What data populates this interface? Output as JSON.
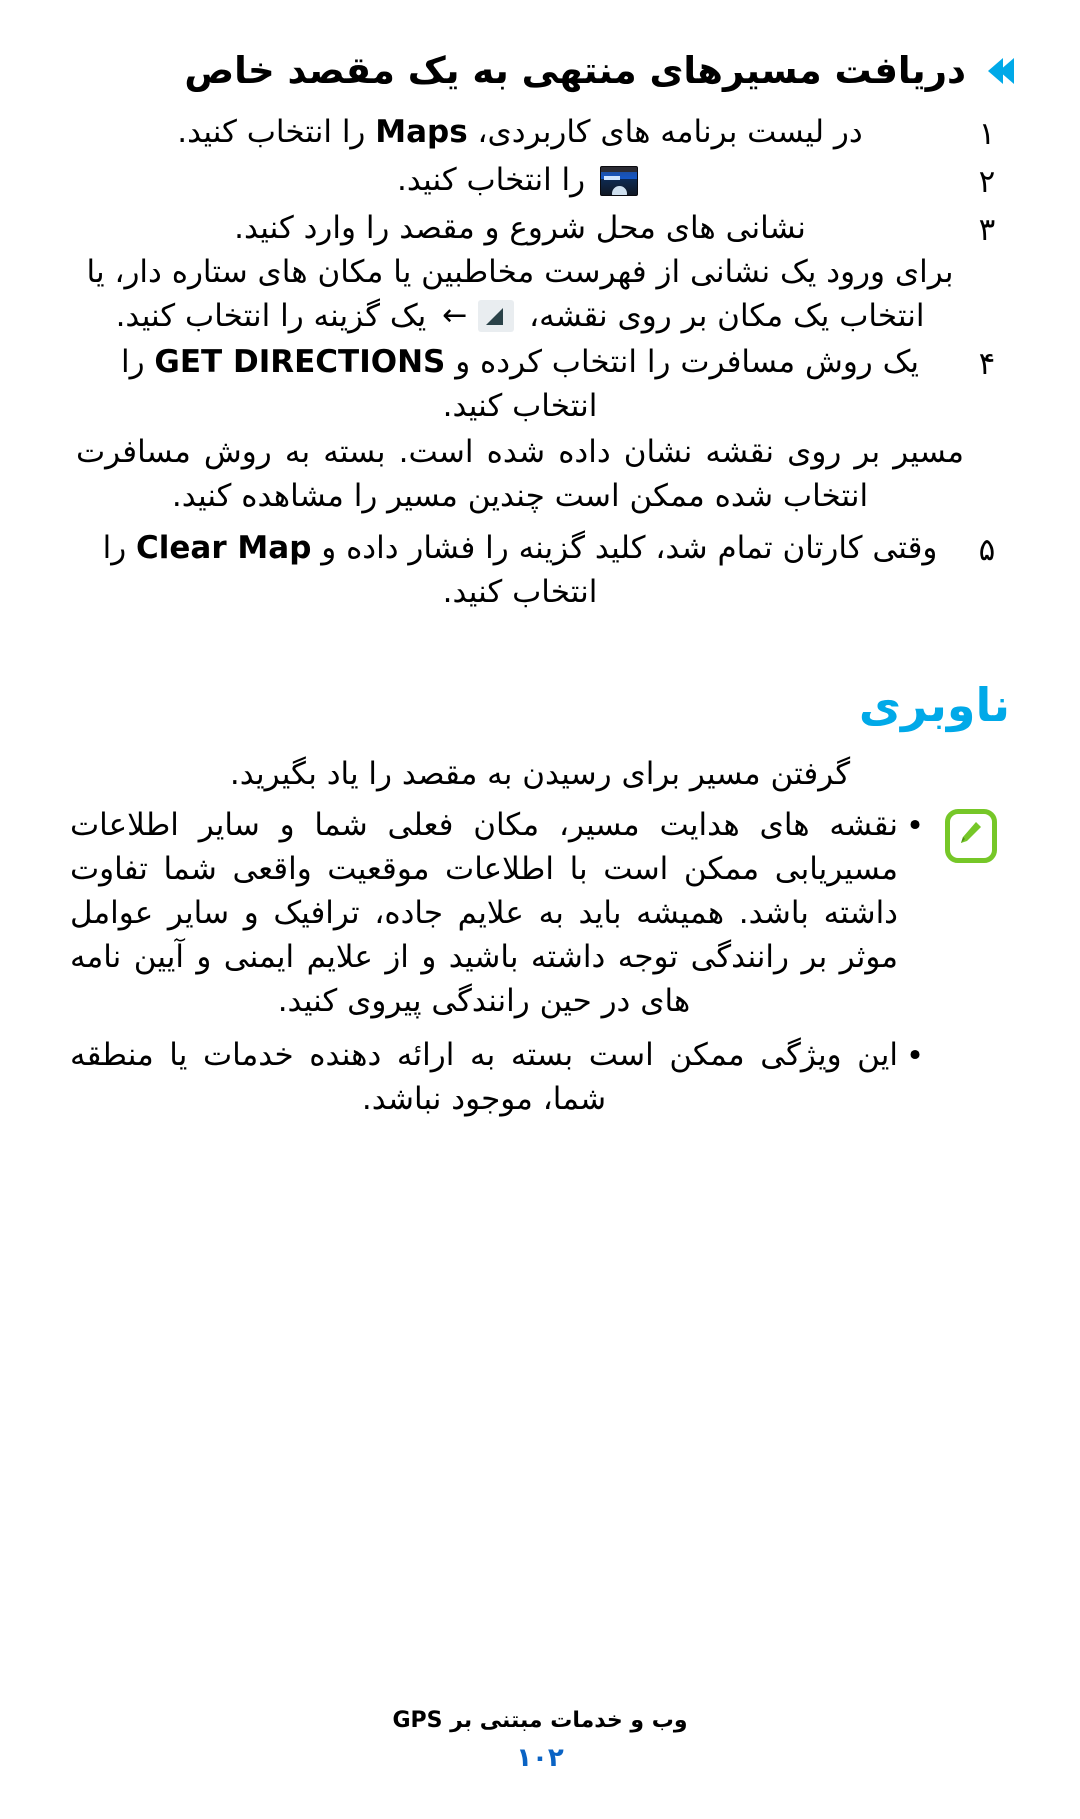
{
  "section": {
    "chevron_icon": "double-chevron-right",
    "title": "دریافت مسیرهای منتهی به یک مقصد خاص"
  },
  "steps": [
    {
      "num": "١",
      "text_before": "در لیست برنامه های کاربردی، ",
      "bold": "Maps",
      "text_after": " را انتخاب کنید."
    },
    {
      "num": "٢",
      "icon": "maps-directions-icon",
      "text_after": " را انتخاب کنید."
    },
    {
      "num": "٣",
      "line1": "نشانی های محل شروع و مقصد را وارد کنید.",
      "line2": "برای ورود یک نشانی از فهرست مخاطبین یا مکان های ستاره دار، یا",
      "line3_a": "انتخاب یک مکان بر روی نقشه، ",
      "line3_icon": "direction-triangle-icon",
      "line3_arrow": "←",
      "line3_b": " یک گزینه را انتخاب کنید."
    },
    {
      "num": "۴",
      "text_before": "یک روش مسافرت را انتخاب کرده و ",
      "bold": "GET DIRECTIONS",
      "text_after": " را انتخاب کنید."
    },
    {
      "num": "۵",
      "text_before": "وقتی کارتان تمام شد، کلید گزینه را فشار داده و ",
      "bold": "Clear Map",
      "text_after": " را انتخاب کنید."
    }
  ],
  "paragraph": "مسیر بر روی نقشه نشان داده شده است. بسته به روش مسافرت انتخاب شده ممکن است چندین مسیر را مشاهده کنید.",
  "navigation": {
    "heading": "ناوبری",
    "intro": "گرفتن مسیر برای رسیدن به مقصد را یاد بگیرید.",
    "note_icon": "note-pencil-icon",
    "bullets": [
      {
        "dot": "•",
        "text": "نقشه های هدایت مسیر، مکان فعلی شما و سایر اطلاعات مسیریابی ممکن است با اطلاعات موقعیت واقعی شما تفاوت داشته باشد. همیشه باید به علایم جاده، ترافیک و سایر عوامل موثر بر رانندگی توجه داشته باشید و از علایم ایمنی و آیین نامه های در حین رانندگی پیروی کنید."
      },
      {
        "dot": "•",
        "text": "این ویژگی ممکن است بسته به ارائه دهنده خدمات یا منطقه شما، موجود نباشد."
      }
    ]
  },
  "footer": {
    "title_before": "وب و خدمات مبتنی بر ",
    "title_latin": "GPS",
    "page_number": "١٠٢"
  }
}
